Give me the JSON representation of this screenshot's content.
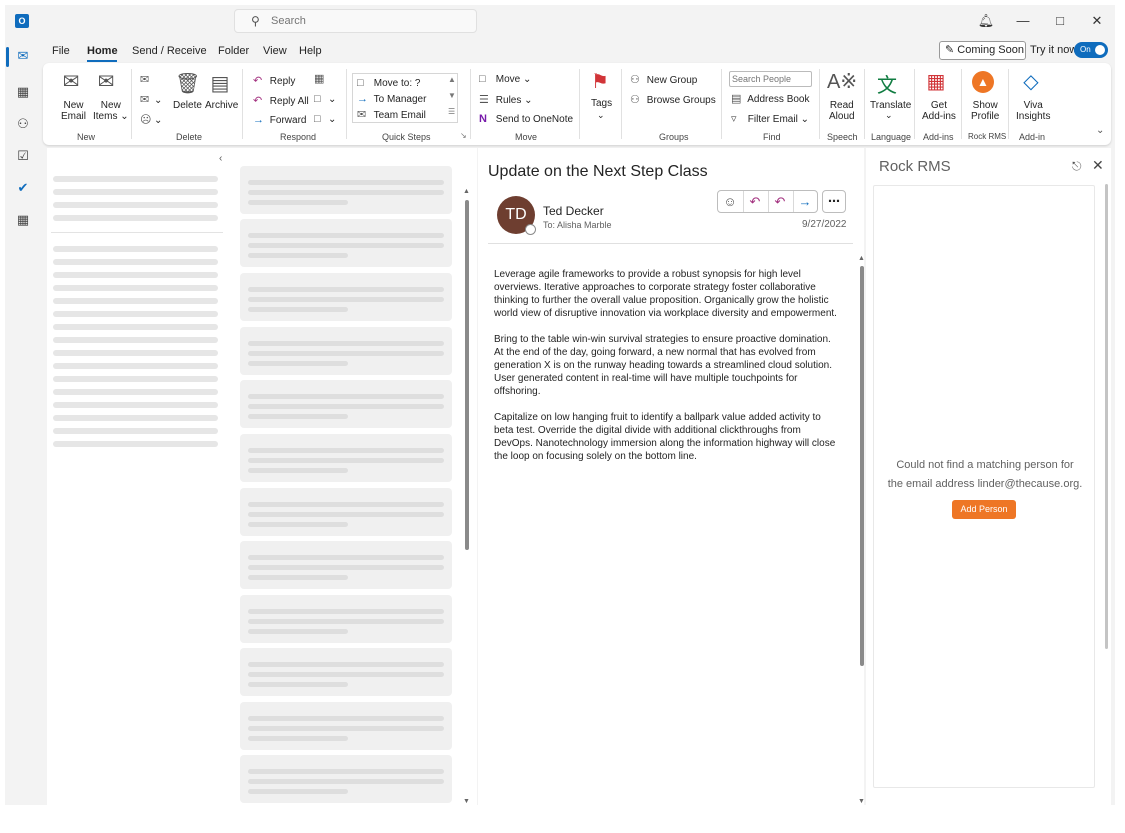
{
  "titlebar": {
    "app_logo": "O",
    "search_placeholder": "Search",
    "icons": [
      "outlook-icon",
      "search-icon",
      "bell-icon",
      "minimize-icon",
      "maximize-icon",
      "close-icon"
    ]
  },
  "appbar": {
    "items": [
      "mail-icon",
      "calendar-icon",
      "people-icon",
      "tasks-icon",
      "todo-icon",
      "apps-icon"
    ]
  },
  "menu": {
    "tabs": [
      "File",
      "Home",
      "Send / Receive",
      "Folder",
      "View",
      "Help"
    ],
    "active_tab": "Home",
    "coming_soon": "Coming Soon",
    "try_it_now": "Try it now",
    "toggle_label": "On"
  },
  "ribbon": {
    "new_group": {
      "new_email": [
        "New",
        "Email"
      ],
      "new_items": [
        "New",
        "Items ⌄"
      ],
      "label": "New"
    },
    "delete_group": {
      "delete": "Delete",
      "archive": "Archive",
      "label": "Delete"
    },
    "respond_group": {
      "reply": "Reply",
      "reply_all": "Reply All",
      "forward": "Forward",
      "label": "Respond"
    },
    "quick_steps": {
      "items": [
        "Move to: ?",
        "To Manager",
        "Team Email"
      ],
      "label": "Quick Steps"
    },
    "move_group": {
      "move": "Move ⌄",
      "rules": "Rules ⌄",
      "onenote": "Send to OneNote",
      "label": "Move"
    },
    "tags": "Tags",
    "groups_group": {
      "new_group": "New Group",
      "browse_groups": "Browse Groups",
      "label": "Groups"
    },
    "find_group": {
      "search_people_placeholder": "Search People",
      "address_book": "Address Book",
      "filter_email": "Filter Email ⌄",
      "label": "Find"
    },
    "speech": {
      "read": "Read",
      "aloud": "Aloud",
      "label": "Speech"
    },
    "language": {
      "translate": "Translate",
      "label": "Language"
    },
    "addins": {
      "get": "Get",
      "addins": "Add-ins",
      "label": "Add-ins"
    },
    "rock_rms": {
      "show": "Show",
      "profile": "Profile",
      "label": "Rock RMS"
    },
    "viva": {
      "viva": "Viva",
      "insights": "Insights",
      "label": "Add-in"
    }
  },
  "email": {
    "subject": "Update on the Next Step Class",
    "avatar_initials": "TD",
    "avatar_color": "#6e3e30",
    "sender": "Ted Decker",
    "to_line": "To: Alisha Marble",
    "date": "9/27/2022",
    "body": [
      "Leverage agile frameworks to provide a robust synopsis for high level overviews. Iterative approaches to corporate strategy foster collaborative thinking to further the overall value proposition. Organically grow the holistic world view of disruptive innovation via workplace diversity and empowerment.",
      "Bring to the table win-win survival strategies to ensure proactive domination. At the end of the day, going forward, a new normal that has evolved from generation X is on the runway heading towards a streamlined cloud solution. User generated content in real-time will have multiple touchpoints for offshoring.",
      "Capitalize on low hanging fruit to identify a ballpark value added activity to beta test. Override the digital divide with additional clickthroughs from DevOps. Nanotechnology immersion along the information highway will close the loop on focusing solely on the bottom line."
    ]
  },
  "addin_pane": {
    "title": "Rock RMS",
    "message_line1": "Could not find a matching person for",
    "message_line2": "the email address linder@thecause.org.",
    "button": "Add Person",
    "button_color": "#ee7625"
  },
  "colors": {
    "accent": "#0f6cbd",
    "reply_purple": "#a3317f"
  }
}
